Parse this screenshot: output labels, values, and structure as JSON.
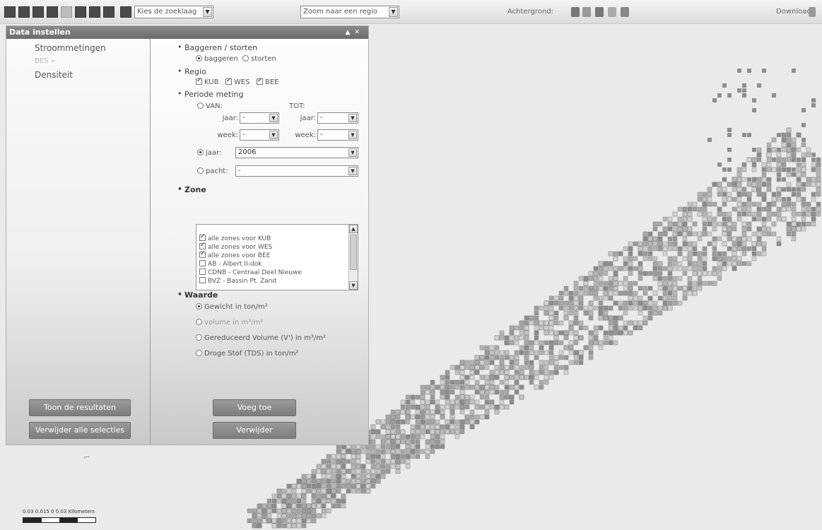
{
  "toolbar": {
    "layer_select": "Kies de zoeklaag",
    "zoom_select": "Zoom naar een regio",
    "background_label": "Achtergrond:",
    "download_label": "Download:"
  },
  "panel": {
    "title": "Data instellen",
    "menu": [
      "Stroommetingen",
      "BES »",
      "Densiteit"
    ],
    "show_results_button": "Toon de resultaten",
    "remove_all_button": "Verwijder alle selecties",
    "add_button": "Voeg toe",
    "remove_button": "Verwijder"
  },
  "form": {
    "section_dredge": "Baggeren / storten",
    "opt_dredge": "baggeren",
    "opt_dump": "storten",
    "section_region": "Regio",
    "regions": [
      "KUB",
      "WES",
      "BEE"
    ],
    "section_period": "Periode meting",
    "from_label": "VAN:",
    "to_label": "TOT:",
    "year_label": "jaar:",
    "week_label": "week:",
    "lease_label": "pacht:",
    "empty_value": "-",
    "year_value": "2006",
    "section_zone": "Zone",
    "zones": [
      "alle zones voor KUB",
      "alle zones voor WES",
      "alle zones voor BEE",
      "AB - Albert II-dok",
      "CDNB - Centraal Deel Nieuwe",
      "BVZ - Bassin Pt. Zand"
    ],
    "section_value": "Waarde",
    "values": [
      "Gewicht in ton/m²",
      "volume in m³/m²",
      "Gereduceerd Volume (V') in m³/m²",
      "Droge Stof (TDS) in ton/m²"
    ]
  },
  "scale": {
    "text": "0.03 0.015    0        0.03 Kilometers"
  },
  "colors": {
    "panel_header": "#7a7a7a",
    "button": "#8a8a8a",
    "map_background": "#eaeaea"
  }
}
